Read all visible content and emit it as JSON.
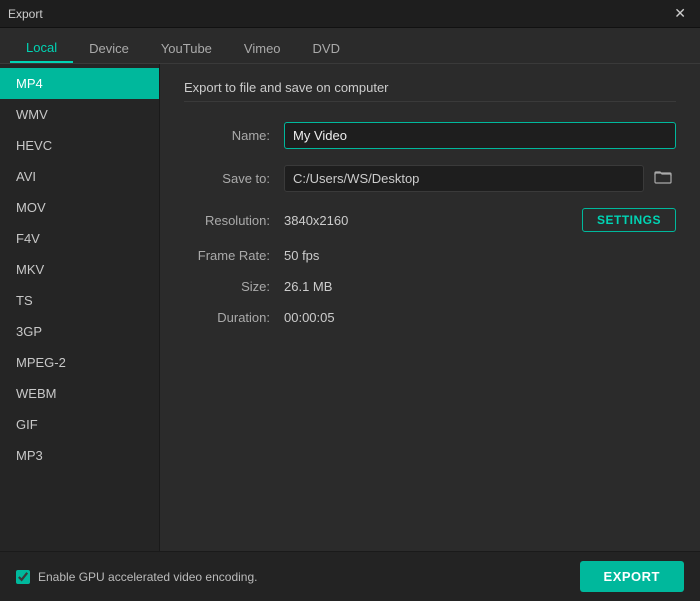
{
  "titlebar": {
    "title": "Export",
    "close_label": "✕"
  },
  "tabs": [
    {
      "id": "local",
      "label": "Local",
      "active": true
    },
    {
      "id": "device",
      "label": "Device",
      "active": false
    },
    {
      "id": "youtube",
      "label": "YouTube",
      "active": false
    },
    {
      "id": "vimeo",
      "label": "Vimeo",
      "active": false
    },
    {
      "id": "dvd",
      "label": "DVD",
      "active": false
    }
  ],
  "sidebar": {
    "items": [
      {
        "id": "mp4",
        "label": "MP4",
        "active": true
      },
      {
        "id": "wmv",
        "label": "WMV",
        "active": false
      },
      {
        "id": "hevc",
        "label": "HEVC",
        "active": false
      },
      {
        "id": "avi",
        "label": "AVI",
        "active": false
      },
      {
        "id": "mov",
        "label": "MOV",
        "active": false
      },
      {
        "id": "f4v",
        "label": "F4V",
        "active": false
      },
      {
        "id": "mkv",
        "label": "MKV",
        "active": false
      },
      {
        "id": "ts",
        "label": "TS",
        "active": false
      },
      {
        "id": "3gp",
        "label": "3GP",
        "active": false
      },
      {
        "id": "mpeg2",
        "label": "MPEG-2",
        "active": false
      },
      {
        "id": "webm",
        "label": "WEBM",
        "active": false
      },
      {
        "id": "gif",
        "label": "GIF",
        "active": false
      },
      {
        "id": "mp3",
        "label": "MP3",
        "active": false
      }
    ]
  },
  "content": {
    "section_title": "Export to file and save on computer",
    "fields": {
      "name_label": "Name:",
      "name_value": "My Video",
      "name_placeholder": "My Video",
      "save_to_label": "Save to:",
      "save_to_path": "C:/Users/WS/Desktop",
      "resolution_label": "Resolution:",
      "resolution_value": "3840x2160",
      "settings_button_label": "SETTINGS",
      "frame_rate_label": "Frame Rate:",
      "frame_rate_value": "50 fps",
      "size_label": "Size:",
      "size_value": "26.1 MB",
      "duration_label": "Duration:",
      "duration_value": "00:00:05"
    }
  },
  "bottom": {
    "checkbox_checked": true,
    "checkbox_label": "Enable GPU accelerated video encoding.",
    "export_button_label": "EXPORT"
  },
  "icons": {
    "folder": "🗁",
    "close": "✕"
  }
}
